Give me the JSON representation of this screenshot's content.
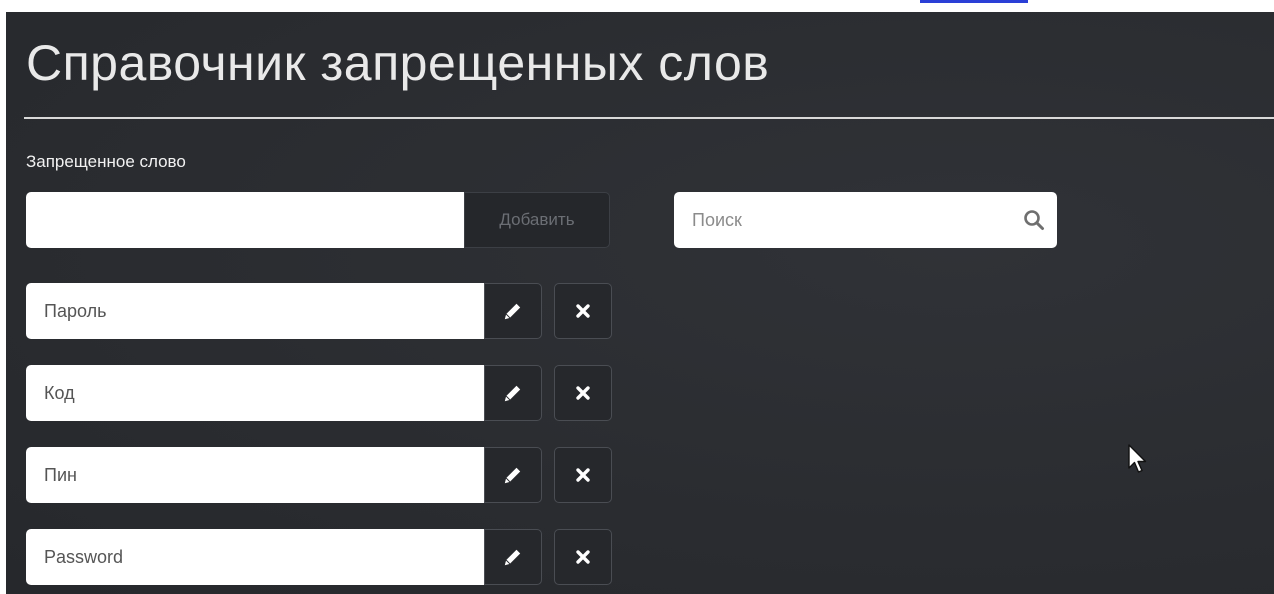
{
  "header_strip": {
    "text": "Справочник запрещенных слов"
  },
  "page": {
    "title": "Справочник запрещенных слов"
  },
  "add_form": {
    "label": "Запрещенное слово",
    "input_value": "",
    "add_label": "Добавить"
  },
  "search": {
    "placeholder": "Поиск",
    "icon": "search-icon"
  },
  "words": [
    {
      "value": "Пароль"
    },
    {
      "value": "Код"
    },
    {
      "value": "Пин"
    },
    {
      "value": "Password"
    }
  ],
  "icons": {
    "edit": "pencil-icon",
    "delete": "close-icon"
  },
  "colors": {
    "panel_bg": "#2b2d31",
    "title": "#e9e9e9",
    "button_bg": "#26282c",
    "input_bg": "#ffffff"
  }
}
